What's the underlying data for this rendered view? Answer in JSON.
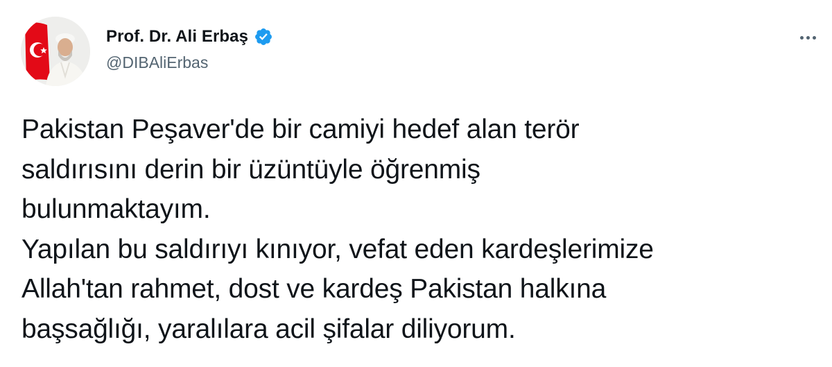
{
  "tweet": {
    "author": {
      "display_name": "Prof. Dr. Ali Erbaş",
      "handle": "@DIBAliErbas",
      "verified": true
    },
    "more_icon": "more-horizontal-icon",
    "text_lines": [
      "Pakistan Peşaver'de bir camiyi hedef alan terör",
      "saldırısını derin bir üzüntüyle öğrenmiş",
      "bulunmaktayım.",
      "Yapılan bu saldırıyı kınıyor, vefat eden kardeşlerimize",
      "Allah'tan rahmet, dost ve kardeş Pakistan halkına",
      "başsağlığı, yaralılara acil şifalar diliyorum."
    ]
  },
  "colors": {
    "text": "#0f1419",
    "secondary": "#536471",
    "verified_badge": "#1d9bf0",
    "flag_red": "#e30a17"
  }
}
